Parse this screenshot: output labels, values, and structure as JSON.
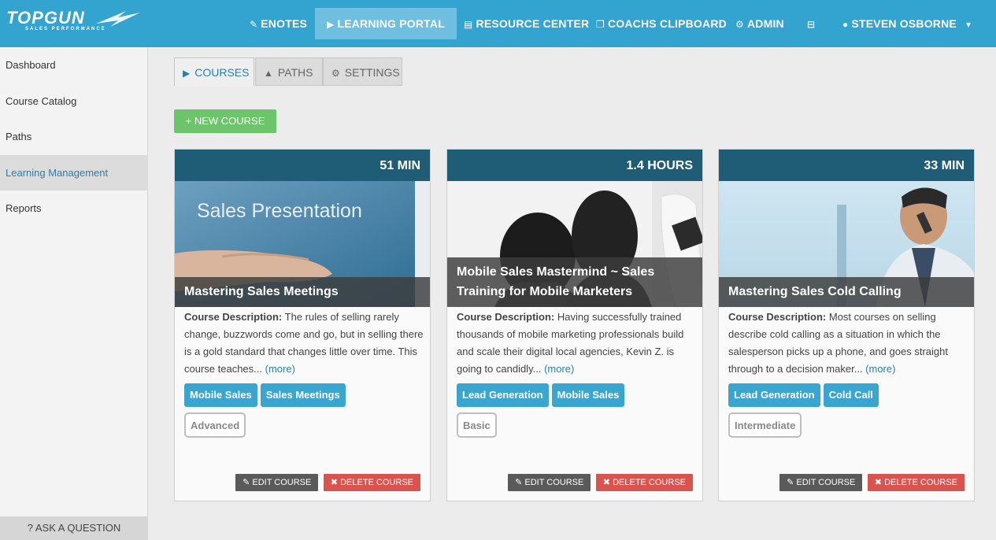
{
  "brand": {
    "logo_text": "TOPGUN",
    "logo_sub": "SALES PERFORMANCE"
  },
  "nav": {
    "enotes": "ENOTES",
    "learning_portal": "LEARNING PORTAL",
    "resource_center": "RESOURCE CENTER",
    "coachs_clipboard": "COACHS CLIPBOARD",
    "admin": "ADMIN",
    "user_name": "STEVEN OSBORNE"
  },
  "sidebar": {
    "items": [
      {
        "label": "Dashboard"
      },
      {
        "label": "Course Catalog"
      },
      {
        "label": "Paths"
      },
      {
        "label": "Learning Management"
      },
      {
        "label": "Reports"
      }
    ],
    "ask_label": "? ASK A QUESTION"
  },
  "tabs": {
    "courses": "COURSES",
    "paths": "PATHS",
    "settings": "SETTINGS"
  },
  "new_course_label": "+ NEW COURSE",
  "desc_label": "Course Description:",
  "more_label": "(more)",
  "edit_label": "EDIT COURSE",
  "delete_label": "DELETE COURSE",
  "image_text": "Sales Presentation",
  "courses": [
    {
      "duration": "51 MIN",
      "title": "Mastering Sales Meetings",
      "description": "The rules of selling rarely change, buzzwords come and go, but in selling there is a gold standard that changes little over time. This course teaches...",
      "tags": [
        "Mobile Sales",
        "Sales Meetings"
      ],
      "level": "Advanced"
    },
    {
      "duration": "1.4 HOURS",
      "title": "Mobile Sales Mastermind ~ Sales Training for Mobile Marketers",
      "description": "Having successfully trained thousands of mobile marketing professionals build and scale their digital local agencies, Kevin Z. is going to candidly...",
      "tags": [
        "Lead Generation",
        "Mobile Sales"
      ],
      "level": "Basic"
    },
    {
      "duration": "33 MIN",
      "title": "Mastering Sales Cold Calling",
      "description": "Most courses on selling describe cold calling as a situation in which the salesperson picks up a phone, and goes straight through to a decision maker...",
      "tags": [
        "Lead Generation",
        "Cold Call"
      ],
      "level": "Intermediate"
    }
  ]
}
